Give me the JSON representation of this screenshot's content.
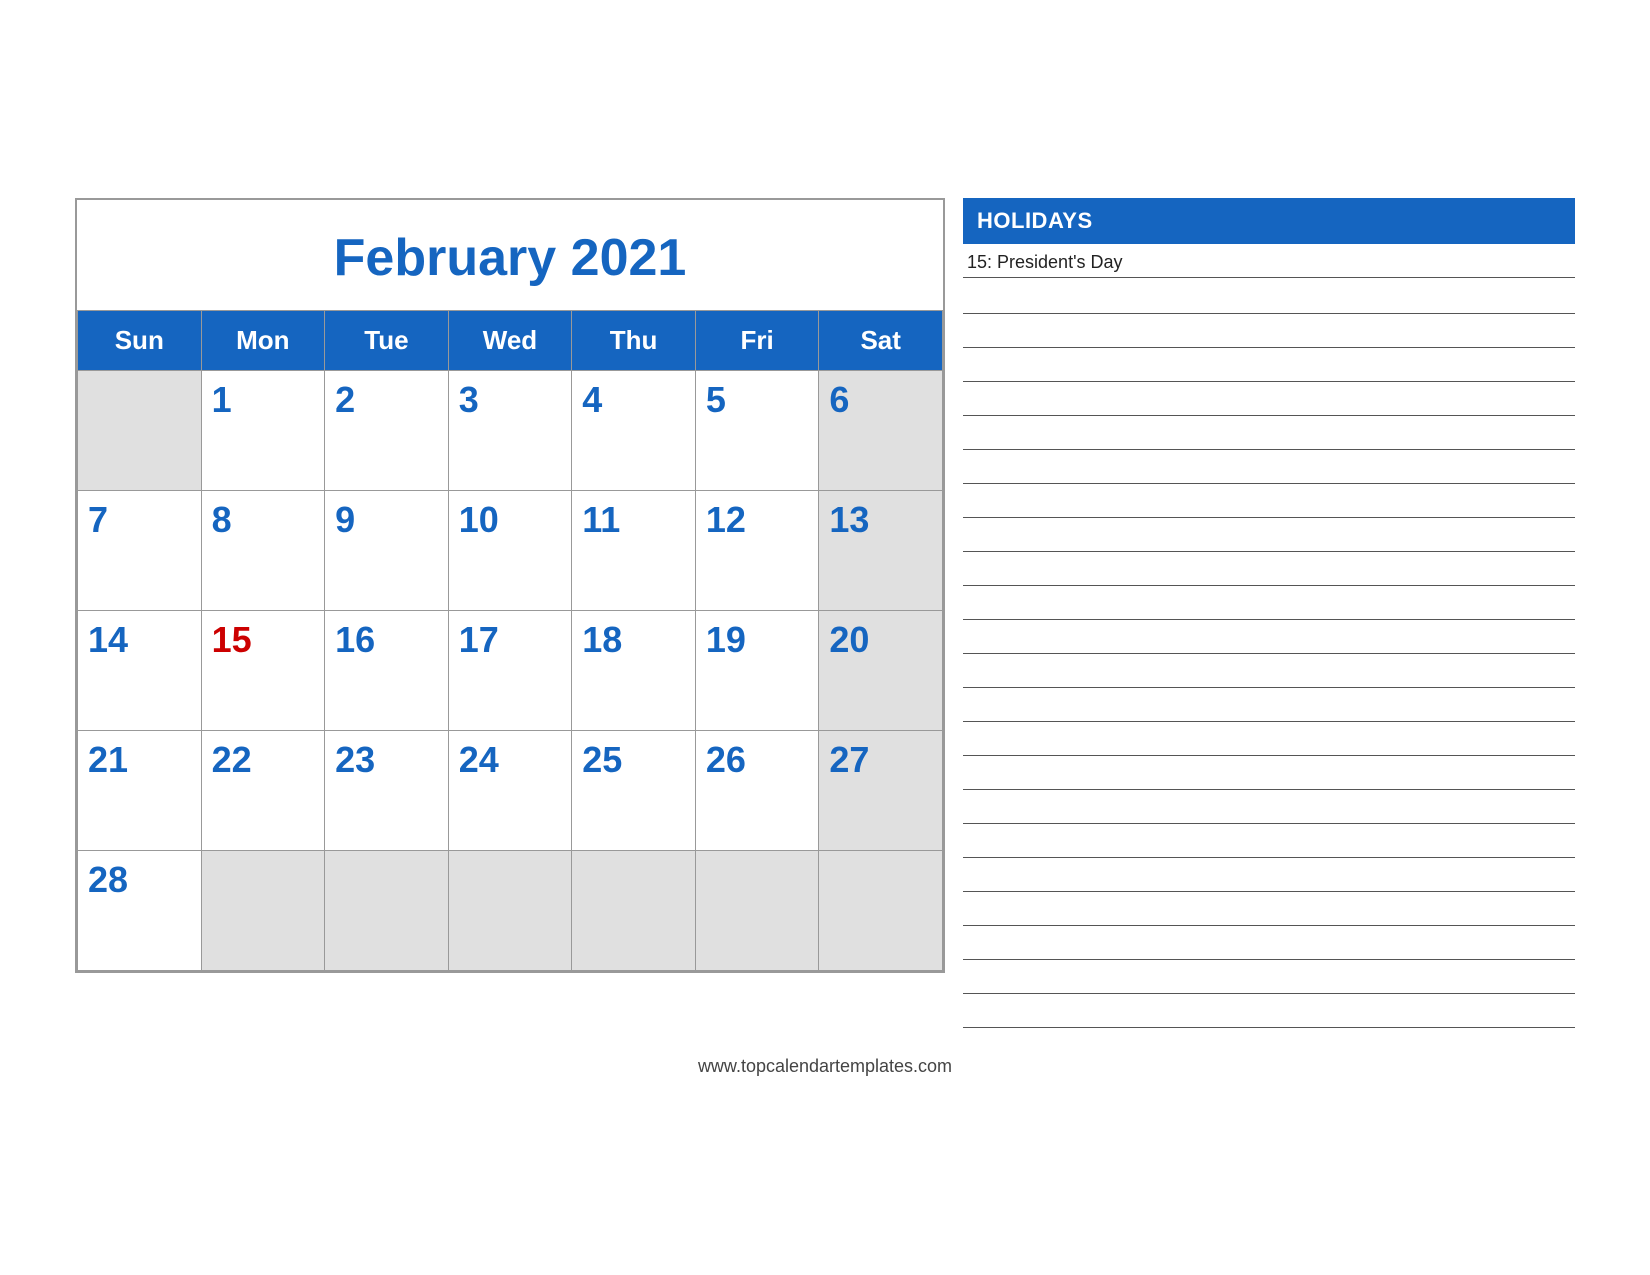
{
  "calendar": {
    "title": "February 2021",
    "days_of_week": [
      "Sun",
      "Mon",
      "Tue",
      "Wed",
      "Thu",
      "Fri",
      "Sat"
    ],
    "weeks": [
      [
        {
          "day": "",
          "type": "empty"
        },
        {
          "day": "1",
          "type": "normal"
        },
        {
          "day": "2",
          "type": "normal"
        },
        {
          "day": "3",
          "type": "normal"
        },
        {
          "day": "4",
          "type": "normal"
        },
        {
          "day": "5",
          "type": "normal"
        },
        {
          "day": "6",
          "type": "weekend"
        }
      ],
      [
        {
          "day": "7",
          "type": "sunday"
        },
        {
          "day": "8",
          "type": "normal"
        },
        {
          "day": "9",
          "type": "normal"
        },
        {
          "day": "10",
          "type": "normal"
        },
        {
          "day": "11",
          "type": "normal"
        },
        {
          "day": "12",
          "type": "normal"
        },
        {
          "day": "13",
          "type": "weekend"
        }
      ],
      [
        {
          "day": "14",
          "type": "sunday"
        },
        {
          "day": "15",
          "type": "holiday"
        },
        {
          "day": "16",
          "type": "normal"
        },
        {
          "day": "17",
          "type": "normal"
        },
        {
          "day": "18",
          "type": "normal"
        },
        {
          "day": "19",
          "type": "normal"
        },
        {
          "day": "20",
          "type": "weekend"
        }
      ],
      [
        {
          "day": "21",
          "type": "sunday"
        },
        {
          "day": "22",
          "type": "normal"
        },
        {
          "day": "23",
          "type": "normal"
        },
        {
          "day": "24",
          "type": "normal"
        },
        {
          "day": "25",
          "type": "normal"
        },
        {
          "day": "26",
          "type": "normal"
        },
        {
          "day": "27",
          "type": "weekend"
        }
      ],
      [
        {
          "day": "28",
          "type": "sunday"
        },
        {
          "day": "",
          "type": "empty"
        },
        {
          "day": "",
          "type": "empty"
        },
        {
          "day": "",
          "type": "empty"
        },
        {
          "day": "",
          "type": "empty"
        },
        {
          "day": "",
          "type": "empty"
        },
        {
          "day": "",
          "type": "empty"
        }
      ]
    ]
  },
  "sidebar": {
    "holidays_header": "HOLIDAYS",
    "holiday_entry": "15: President's Day",
    "note_lines_count": 22
  },
  "footer": {
    "website": "www.topcalendartemplates.com"
  }
}
